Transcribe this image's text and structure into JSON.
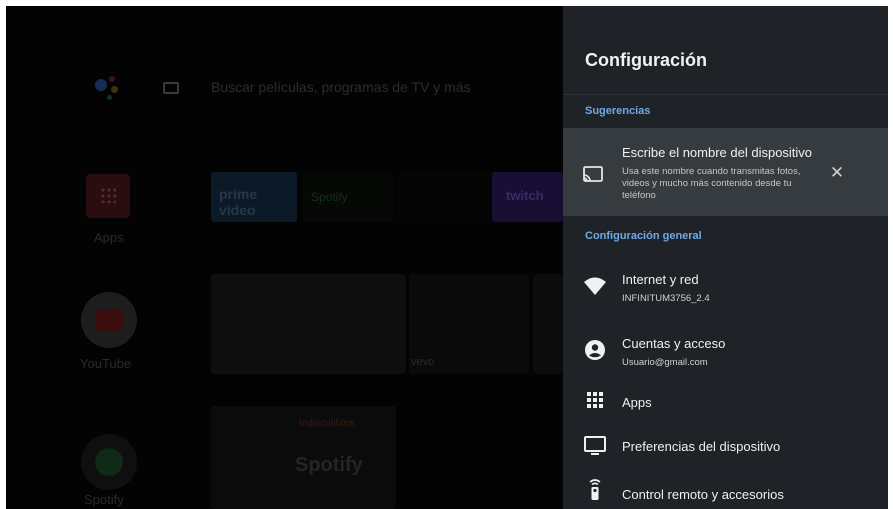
{
  "background": {
    "search_placeholder": "Buscar películas, programas de TV y más",
    "apps_label": "Apps",
    "tiles": {
      "prime": "prime video",
      "spotify": "Spotify",
      "twitch": "twitch",
      "vevo": "vevo",
      "spotify_sub": "Indiscutibles",
      "spotify_brand": "Spotify"
    },
    "youtube_label": "YouTube",
    "spotify_label": "Spotify"
  },
  "settings": {
    "title": "Configuración",
    "suggestions_header": "Sugerencias",
    "suggestion": {
      "title": "Escribe el nombre del dispositivo",
      "description": "Usa este nombre cuando transmitas fotos, videos y mucho más contenido desde tu teléfono",
      "close_symbol": "✕",
      "icon": "cast-icon"
    },
    "general_header": "Configuración general",
    "items": [
      {
        "label": "Internet y red",
        "subtitle": "INFINITUM3756_2.4",
        "icon": "wifi-icon"
      },
      {
        "label": "Cuentas y acceso",
        "subtitle": "Usuario@gmail.com",
        "icon": "account-icon"
      },
      {
        "label": "Apps",
        "subtitle": "",
        "icon": "apps-grid-icon"
      },
      {
        "label": "Preferencias del dispositivo",
        "subtitle": "",
        "icon": "tv-icon"
      },
      {
        "label": "Control remoto y accesorios",
        "subtitle": "",
        "icon": "remote-icon"
      }
    ]
  },
  "colors": {
    "panel_bg": "#1f2327",
    "highlight_bg": "#363b40",
    "section_header": "#6fa8e8"
  }
}
